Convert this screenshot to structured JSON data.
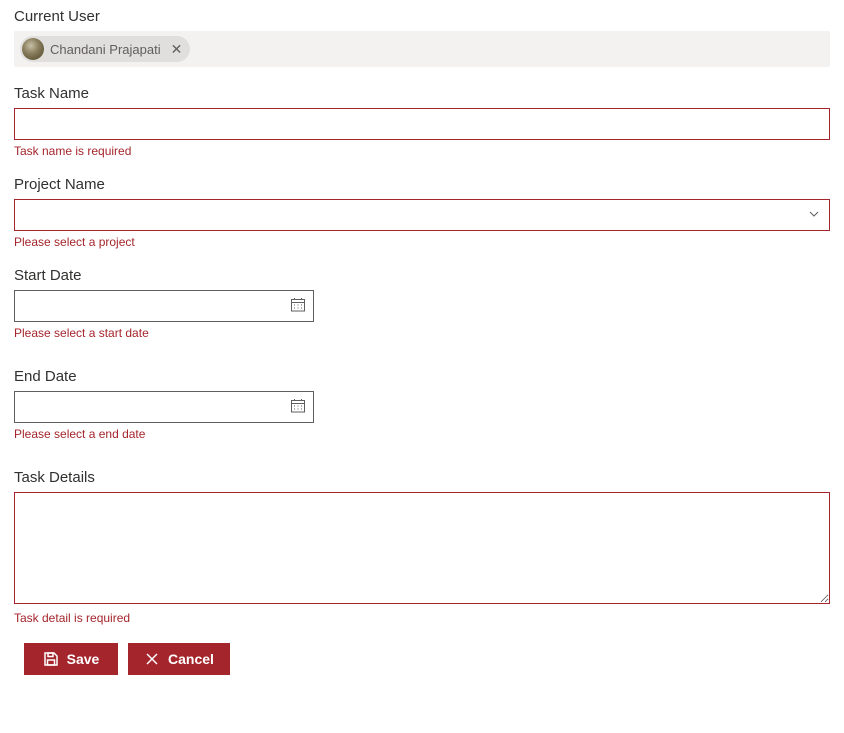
{
  "currentUser": {
    "label": "Current User",
    "chipName": "Chandani Prajapati"
  },
  "taskName": {
    "label": "Task Name",
    "value": "",
    "error": "Task name is required"
  },
  "projectName": {
    "label": "Project Name",
    "value": "",
    "error": "Please select a project"
  },
  "startDate": {
    "label": "Start Date",
    "value": "",
    "error": "Please select a start date"
  },
  "endDate": {
    "label": "End Date",
    "value": "",
    "error": "Please select a end date"
  },
  "taskDetails": {
    "label": "Task Details",
    "value": "",
    "error": "Task detail is required"
  },
  "buttons": {
    "save": "Save",
    "cancel": "Cancel"
  }
}
